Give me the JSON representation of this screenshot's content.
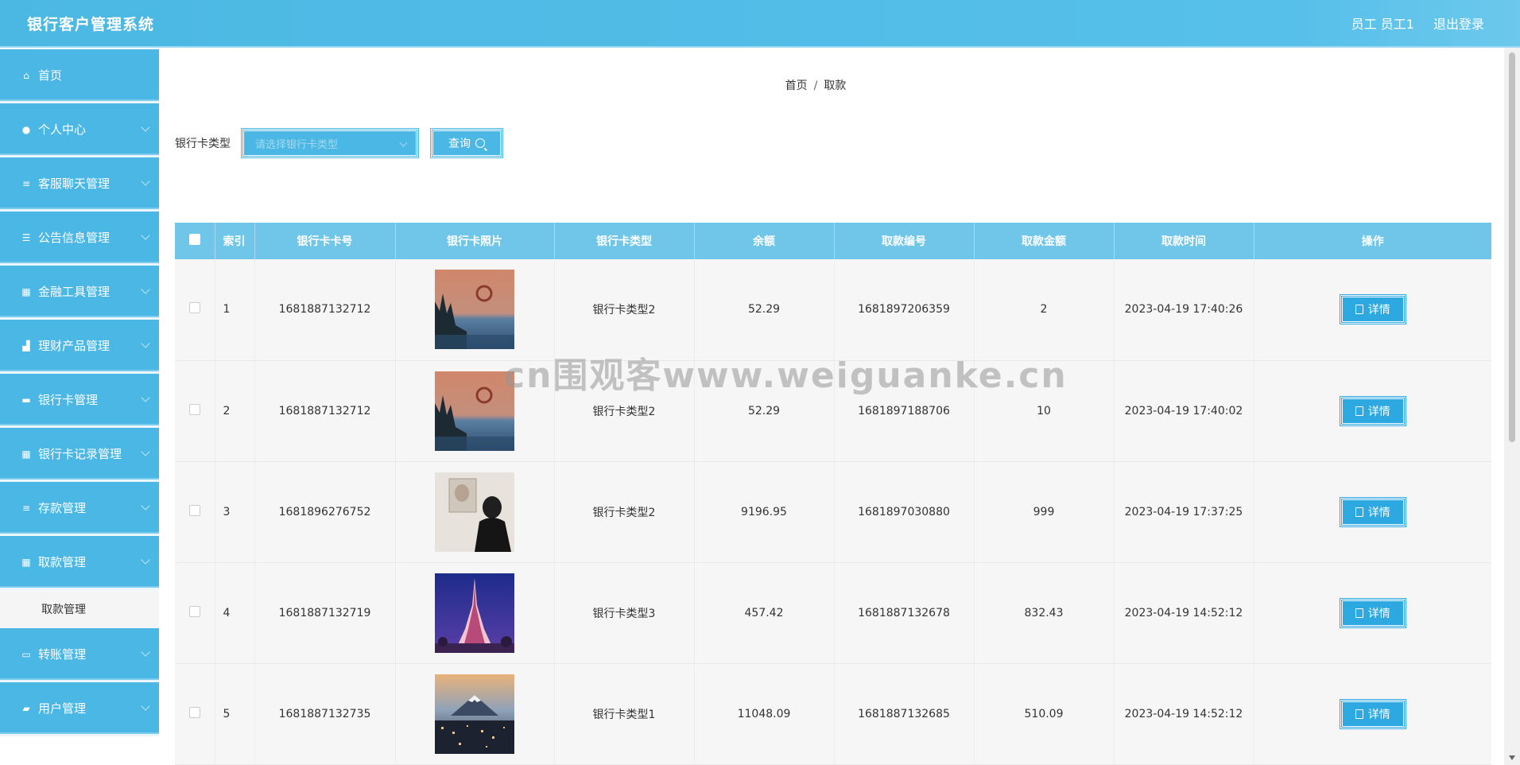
{
  "header": {
    "title": "银行客户管理系统",
    "user_label": "员工 员工1",
    "logout_label": "退出登录"
  },
  "sidebar": {
    "items": [
      {
        "label": "首页",
        "icon": "home-icon",
        "has_arrow": false
      },
      {
        "label": "个人中心",
        "icon": "user-icon",
        "has_arrow": true
      },
      {
        "label": "客服聊天管理",
        "icon": "list-icon",
        "has_arrow": true
      },
      {
        "label": "公告信息管理",
        "icon": "sliders-icon",
        "has_arrow": true
      },
      {
        "label": "金融工具管理",
        "icon": "grid-icon",
        "has_arrow": true
      },
      {
        "label": "理财产品管理",
        "icon": "chart-icon",
        "has_arrow": true
      },
      {
        "label": "银行卡管理",
        "icon": "card-icon",
        "has_arrow": true
      },
      {
        "label": "银行卡记录管理",
        "icon": "grid-icon",
        "has_arrow": true
      },
      {
        "label": "存款管理",
        "icon": "list-icon",
        "has_arrow": true
      },
      {
        "label": "取款管理",
        "icon": "grid-icon",
        "has_arrow": true
      }
    ],
    "submenu": {
      "label": "取款管理"
    },
    "items_after": [
      {
        "label": "转账管理",
        "icon": "monitor-icon",
        "has_arrow": true
      },
      {
        "label": "用户管理",
        "icon": "users-icon",
        "has_arrow": true
      }
    ]
  },
  "breadcrumb": {
    "home": "首页",
    "separator": "/",
    "current": "取款"
  },
  "filter": {
    "label": "银行卡类型",
    "placeholder": "请选择银行卡类型",
    "search_label": "查询"
  },
  "table": {
    "columns": [
      "索引",
      "银行卡卡号",
      "银行卡照片",
      "银行卡类型",
      "余额",
      "取款编号",
      "取款金额",
      "取款时间",
      "操作"
    ],
    "rows": [
      {
        "index": "1",
        "card_no": "1681887132712",
        "photo": "lake-sunset",
        "card_type": "银行卡类型2",
        "balance": "52.29",
        "withdraw_no": "1681897206359",
        "amount": "2",
        "time": "2023-04-19 17:40:26",
        "action": "详情"
      },
      {
        "index": "2",
        "card_no": "1681887132712",
        "photo": "lake-sunset",
        "card_type": "银行卡类型2",
        "balance": "52.29",
        "withdraw_no": "1681897188706",
        "amount": "10",
        "time": "2023-04-19 17:40:02",
        "action": "详情"
      },
      {
        "index": "3",
        "card_no": "1681896276752",
        "photo": "person-mirror",
        "card_type": "银行卡类型2",
        "balance": "9196.95",
        "withdraw_no": "1681897030880",
        "amount": "999",
        "time": "2023-04-19 17:37:25",
        "action": "详情"
      },
      {
        "index": "4",
        "card_no": "1681887132719",
        "photo": "eiffel-tower",
        "card_type": "银行卡类型3",
        "balance": "457.42",
        "withdraw_no": "1681887132678",
        "amount": "832.43",
        "time": "2023-04-19 14:52:12",
        "action": "详情"
      },
      {
        "index": "5",
        "card_no": "1681887132735",
        "photo": "mount-fuji-city",
        "card_type": "银行卡类型1",
        "balance": "11048.09",
        "withdraw_no": "1681887132685",
        "amount": "510.09",
        "time": "2023-04-19 14:52:12",
        "action": "详情"
      }
    ]
  },
  "watermark": "cn围观客www.weiguanke.cn",
  "colors": {
    "primary": "#4ab7e5",
    "header_row": "#6fc6e8",
    "detail_button": "#2da8e0"
  }
}
